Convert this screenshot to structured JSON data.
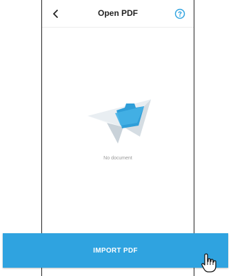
{
  "header": {
    "title": "Open PDF",
    "back_icon": "chevron-left-icon",
    "help_icon": "help-circle-icon"
  },
  "main": {
    "empty_state_text": "No document",
    "illustration": "paper-plane-with-folder"
  },
  "footer": {
    "import_label": "IMPORT PDF"
  },
  "colors": {
    "accent": "#2fa3e0",
    "text_primary": "#222222",
    "text_muted": "#9a9a9a"
  }
}
